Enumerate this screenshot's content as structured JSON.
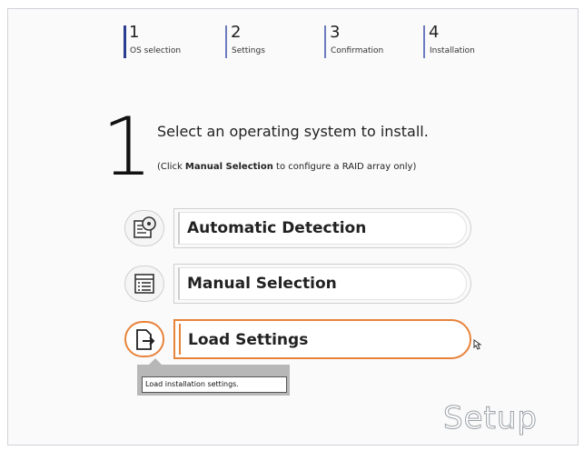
{
  "steps": [
    {
      "num": "1",
      "label": "OS selection"
    },
    {
      "num": "2",
      "label": "Settings"
    },
    {
      "num": "3",
      "label": "Confirmation"
    },
    {
      "num": "4",
      "label": "Installation"
    }
  ],
  "current_step": "1",
  "heading": "Select an operating system to install.",
  "hint": {
    "prefix": "(Click ",
    "bold": "Manual Selection",
    "suffix": " to configure a RAID array only)"
  },
  "options": [
    {
      "label": "Automatic Detection",
      "icon": "disc-detect-icon"
    },
    {
      "label": "Manual Selection",
      "icon": "list-icon"
    },
    {
      "label": "Load Settings",
      "icon": "load-file-icon"
    }
  ],
  "tooltip": "Load installation settings.",
  "brand": "Setup",
  "colors": {
    "accent": "#e8833a",
    "step_bar": "#2a3d8f",
    "border": "#cfcfcf"
  }
}
